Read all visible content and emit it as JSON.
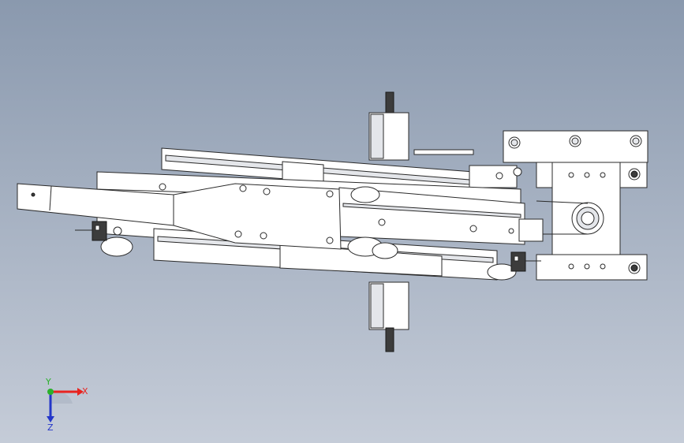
{
  "viewport": {
    "background_top": "#8a99ae",
    "background_bottom": "#c5ccd8"
  },
  "model": {
    "part_fill": "#ffffff",
    "edge_color": "#2a2a2a",
    "shade_color": "#d6d8dc",
    "dark_part": "#3a3a3a"
  },
  "triad": {
    "x_label": "X",
    "y_label": "Y",
    "z_label": "Z",
    "x_color": "#e8231f",
    "y_color": "#2bb12b",
    "z_color": "#2436c9"
  }
}
